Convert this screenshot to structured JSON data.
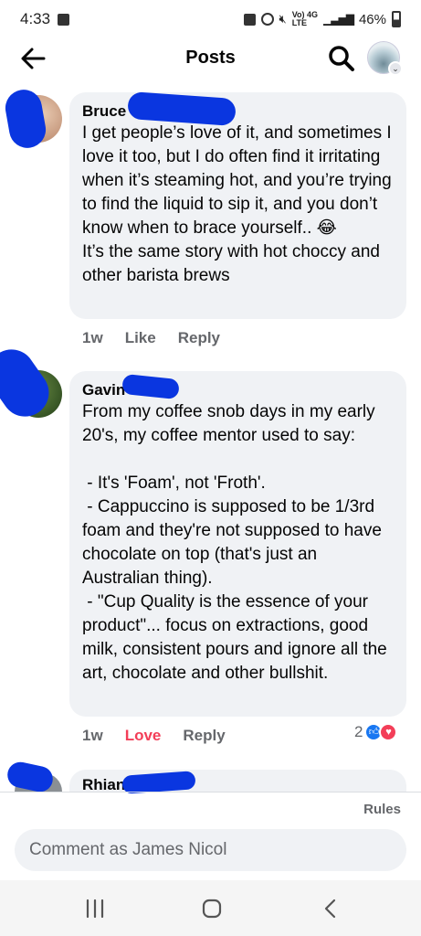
{
  "status_bar": {
    "time": "4:33",
    "network_label": "Vo) 4G",
    "network_sub": "LTE",
    "battery": "46%"
  },
  "header": {
    "title": "Posts"
  },
  "comments": [
    {
      "author": "Bruce",
      "text": "I get people’s love of it, and sometimes I love it too, but I do often find it irritating when it’s steaming hot, and you’re trying to find the liquid to sip it, and you don’t know when to brace yourself.. 😂\nIt’s the same story with hot choccy and other barista brews",
      "time": "1w",
      "like_label": "Like",
      "reply_label": "Reply"
    },
    {
      "author": "Gavin",
      "text": "From my coffee snob days in my early 20's, my coffee mentor used to say:\n\n - It's 'Foam', not 'Froth'.\n - Cappuccino is supposed to be 1/3rd foam and they're not supposed to have chocolate on top (that's just an Australian thing).\n - \"Cup Quality is the essence of your product\"... focus on extractions, good milk, consistent pours and ignore all the art, chocolate and other bullshit.",
      "time": "1w",
      "like_label": "Love",
      "reply_label": "Reply",
      "reaction_count": "2"
    },
    {
      "author": "Rhian"
    }
  ],
  "composer": {
    "rules_label": "Rules",
    "placeholder": "Comment as James Nicol"
  },
  "colors": {
    "accent": "#1877f2",
    "love": "#f33e58",
    "bubble": "#f0f2f5",
    "redaction": "#0a36e0"
  }
}
